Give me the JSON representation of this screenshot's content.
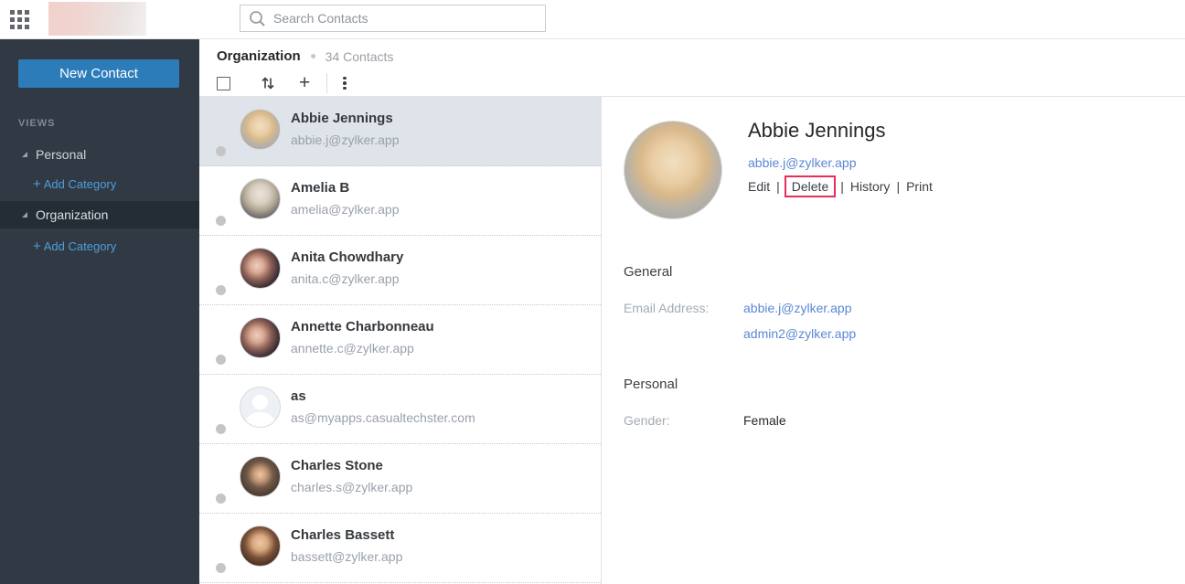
{
  "topbar": {
    "search_placeholder": "Search Contacts"
  },
  "icons": {
    "app_launcher": "grid-3x3",
    "search": "magnifier",
    "sort": "up-down-arrows",
    "add": "+",
    "more_options": "kebab-vertical-dots",
    "collapse": "triangle"
  },
  "sidebar": {
    "new_contact_label": "New Contact",
    "views_label": "VIEWS",
    "groups": [
      {
        "label": "Personal",
        "add_label": "Add Category",
        "selected": false
      },
      {
        "label": "Organization",
        "add_label": "Add Category",
        "selected": true
      }
    ],
    "add_plus": "+"
  },
  "list_header": {
    "title": "Organization",
    "count": "34 Contacts"
  },
  "contacts": [
    {
      "name": "Abbie Jennings",
      "email": "abbie.j@zylker.app",
      "selected": true,
      "avatar": "blonde-woman-photo"
    },
    {
      "name": "Amelia B",
      "email": "amelia@zylker.app",
      "selected": false,
      "avatar": "gray-blonde-woman-photo"
    },
    {
      "name": "Anita Chowdhary",
      "email": "anita.c@zylker.app",
      "selected": false,
      "avatar": "dark-haired-woman-photo"
    },
    {
      "name": "Annette Charbonneau",
      "email": "annette.c@zylker.app",
      "selected": false,
      "avatar": "dark-haired-woman-photo"
    },
    {
      "name": "as",
      "email": "as@myapps.casualtechster.com",
      "selected": false,
      "avatar": "default-silhouette"
    },
    {
      "name": "Charles Stone",
      "email": "charles.s@zylker.app",
      "selected": false,
      "avatar": "bearded-man-photo"
    },
    {
      "name": "Charles Bassett",
      "email": "bassett@zylker.app",
      "selected": false,
      "avatar": "smiling-man-photo"
    }
  ],
  "detail": {
    "name": "Abbie Jennings",
    "email": "abbie.j@zylker.app",
    "actions": {
      "edit": "Edit",
      "delete": "Delete",
      "history": "History",
      "print": "Print"
    },
    "action_separator": "|",
    "highlighted_action": "Delete",
    "sections": {
      "general": {
        "title": "General",
        "email_label": "Email Address:",
        "emails": [
          "abbie.j@zylker.app",
          "admin2@zylker.app"
        ]
      },
      "personal": {
        "title": "Personal",
        "gender_label": "Gender:",
        "gender_value": "Female"
      }
    }
  },
  "colors": {
    "accent_blue": "#2d7cba",
    "link_blue": "#5b87d5",
    "sidebar_bg": "#313a44",
    "sidebar_selected": "#242c35",
    "add_category_blue": "#4d9fda",
    "selected_row_bg": "#dfe4ea",
    "highlight_red": "#ea2c5a"
  }
}
